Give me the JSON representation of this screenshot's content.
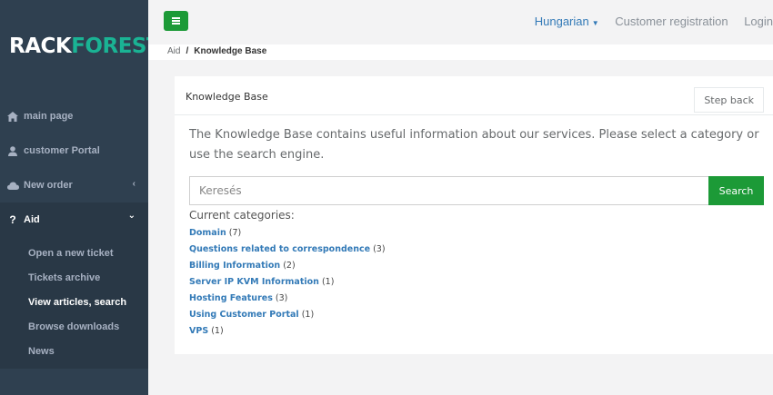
{
  "sidebar": {
    "logo_rack": "RACK",
    "logo_forest": "FOREST",
    "items": [
      {
        "label": "main page",
        "icon": "home-icon"
      },
      {
        "label": "customer Portal",
        "icon": "user-icon"
      },
      {
        "label": "New order",
        "icon": "cloud-icon",
        "arrow": "‹"
      },
      {
        "label": "Aid",
        "icon": "question-icon",
        "arrow": "⌄"
      }
    ],
    "submenu": [
      {
        "label": "Open a new ticket"
      },
      {
        "label": "Tickets archive"
      },
      {
        "label": "View articles, search"
      },
      {
        "label": "Browse downloads"
      },
      {
        "label": "News"
      }
    ]
  },
  "topbar": {
    "language": "Hungarian",
    "customer_registration": "Customer registration",
    "login": "Login"
  },
  "breadcrumb": {
    "root": "Aid",
    "separator": "/",
    "current": "Knowledge Base"
  },
  "panel": {
    "title": "Knowledge Base",
    "step_back": "Step back",
    "intro": "The Knowledge Base contains useful information about our services. Please select a category or use the search engine.",
    "search_placeholder": "Keresés",
    "search_button": "Search",
    "categories_title": "Current categories:",
    "categories": [
      {
        "name": "Domain",
        "count": "(7)"
      },
      {
        "name": "Questions related to correspondence",
        "count": "(3)"
      },
      {
        "name": "Billing Information",
        "count": "(2)"
      },
      {
        "name": "Server IP KVM Information",
        "count": "(1)"
      },
      {
        "name": "Hosting Features",
        "count": "(3)"
      },
      {
        "name": "Using Customer Portal",
        "count": "(1)"
      },
      {
        "name": "VPS",
        "count": "(1)"
      }
    ]
  },
  "colors": {
    "sidebar_bg": "#2f4050",
    "accent_green": "#1c9a37",
    "link_blue": "#337ab7",
    "logo_forest": "#1ab394"
  }
}
